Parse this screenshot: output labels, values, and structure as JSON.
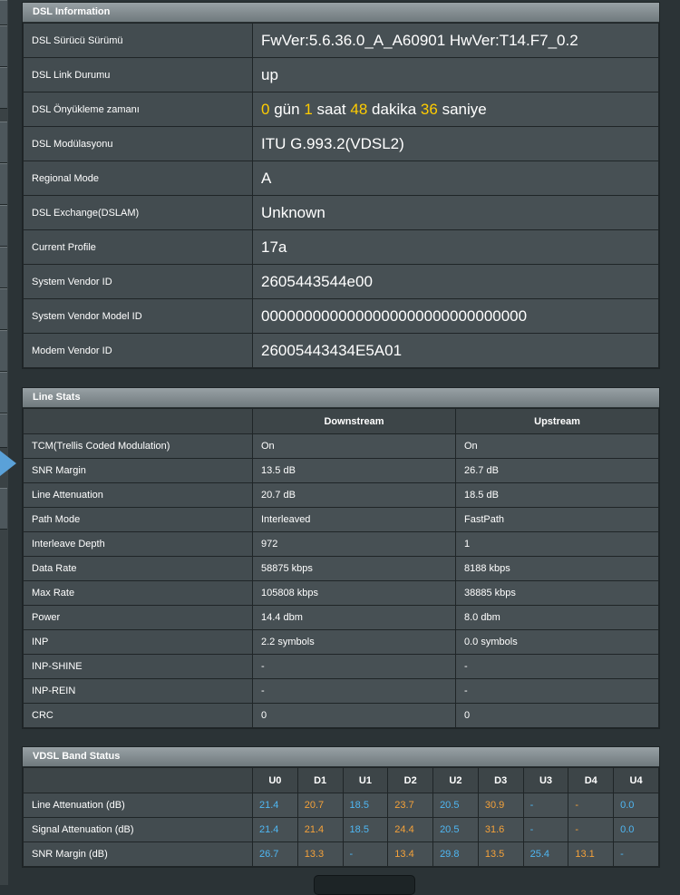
{
  "dsl_info": {
    "title": "DSL Information",
    "rows": [
      {
        "label": "DSL Sürücü Sürümü",
        "value": "FwVer:5.6.36.0_A_A60901 HwVer:T14.F7_0.2"
      },
      {
        "label": "DSL Link Durumu",
        "value": "up"
      },
      {
        "label": "DSL Önyükleme zamanı",
        "uptime": {
          "days": "0",
          "days_unit": "gün",
          "hours": "1",
          "hours_unit": "saat",
          "minutes": "48",
          "minutes_unit": "dakika",
          "seconds": "36",
          "seconds_unit": "saniye"
        }
      },
      {
        "label": "DSL Modülasyonu",
        "value": "ITU G.993.2(VDSL2)"
      },
      {
        "label": "Regional Mode",
        "value": "A"
      },
      {
        "label": "DSL Exchange(DSLAM)",
        "value": "Unknown"
      },
      {
        "label": "Current Profile",
        "value": "17a"
      },
      {
        "label": "System Vendor ID",
        "value": "2605443544e00"
      },
      {
        "label": "System Vendor Model ID",
        "value": "0000000000000000000000000000000"
      },
      {
        "label": "Modem Vendor ID",
        "value": "26005443434E5A01"
      }
    ]
  },
  "line_stats": {
    "title": "Line Stats",
    "columns": [
      "Downstream",
      "Upstream"
    ],
    "rows": [
      {
        "label": "TCM(Trellis Coded Modulation)",
        "down": "On",
        "up": "On"
      },
      {
        "label": "SNR Margin",
        "down": "13.5 dB",
        "up": "26.7 dB"
      },
      {
        "label": "Line Attenuation",
        "down": "20.7 dB",
        "up": "18.5 dB"
      },
      {
        "label": "Path Mode",
        "down": "Interleaved",
        "up": "FastPath"
      },
      {
        "label": "Interleave Depth",
        "down": "972",
        "up": "1"
      },
      {
        "label": "Data Rate",
        "down": "58875 kbps",
        "up": "8188 kbps"
      },
      {
        "label": "Max Rate",
        "down": "105808 kbps",
        "up": "38885 kbps"
      },
      {
        "label": "Power",
        "down": "14.4 dbm",
        "up": "8.0 dbm"
      },
      {
        "label": "INP",
        "down": "2.2 symbols",
        "up": "0.0 symbols"
      },
      {
        "label": "INP-SHINE",
        "down": "-",
        "up": "-"
      },
      {
        "label": "INP-REIN",
        "down": "-",
        "up": "-"
      },
      {
        "label": "CRC",
        "down": "0",
        "up": "0"
      }
    ]
  },
  "band_status": {
    "title": "VDSL Band Status",
    "bands": [
      "U0",
      "D1",
      "U1",
      "D2",
      "U2",
      "D3",
      "U3",
      "D4",
      "U4"
    ],
    "rows": [
      {
        "label": "Line Attenuation (dB)",
        "values": [
          "21.4",
          "20.7",
          "18.5",
          "23.7",
          "20.5",
          "30.9",
          "-",
          "-",
          "0.0"
        ]
      },
      {
        "label": "Signal Attenuation (dB)",
        "values": [
          "21.4",
          "21.4",
          "18.5",
          "24.4",
          "20.5",
          "31.6",
          "-",
          "-",
          "0.0"
        ]
      },
      {
        "label": "SNR Margin (dB)",
        "values": [
          "26.7",
          "13.3",
          "-",
          "13.4",
          "29.8",
          "13.5",
          "25.4",
          "13.1",
          "-"
        ]
      }
    ]
  },
  "colors": {
    "upstream_value": "#4fb7f3",
    "downstream_value": "#f5a23a",
    "uptime_highlight": "#ffcc00"
  }
}
